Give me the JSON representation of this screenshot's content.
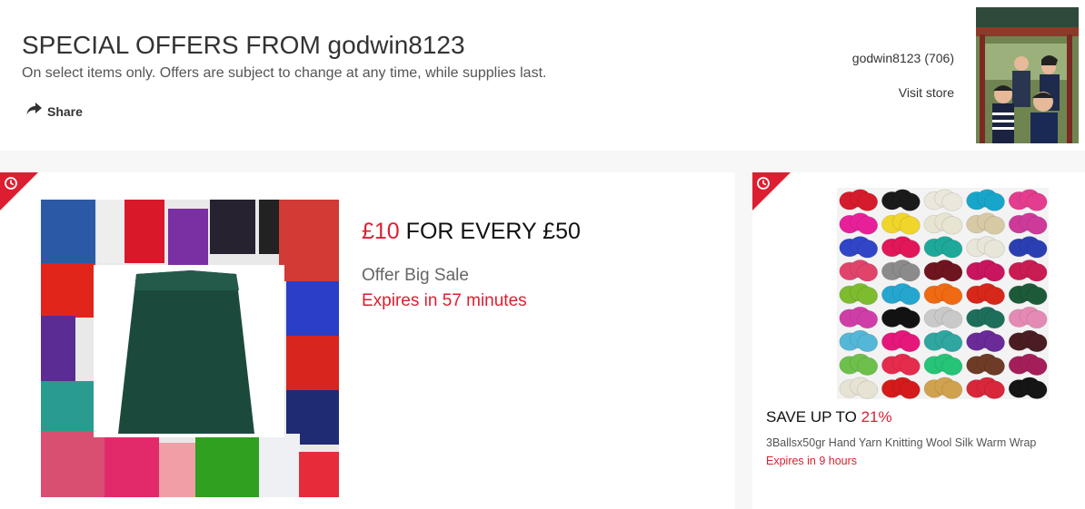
{
  "header": {
    "title": "SPECIAL OFFERS FROM godwin8123",
    "subtitle": "On select items only. Offers are subject to change at any time, while supplies last.",
    "share_label": "Share",
    "seller_name": "godwin8123",
    "seller_feedback": "(706)",
    "visit_store_label": "Visit store"
  },
  "offer_main": {
    "amount_highlight": "£10",
    "amount_rest": "FOR EVERY £50",
    "description": "Offer Big Sale",
    "expiry": "Expires in 57 minutes"
  },
  "offer_item": {
    "save_prefix": "SAVE UP TO",
    "save_percent": "21%",
    "name": "3Ballsx50gr Hand Yarn Knitting Wool Silk Warm Wrap",
    "expiry": "Expires in 9 hours"
  },
  "colors": {
    "accent_red": "#dd1e31",
    "text_dark": "#333333"
  },
  "icons": [
    "share-arrow-icon",
    "clock-icon"
  ]
}
